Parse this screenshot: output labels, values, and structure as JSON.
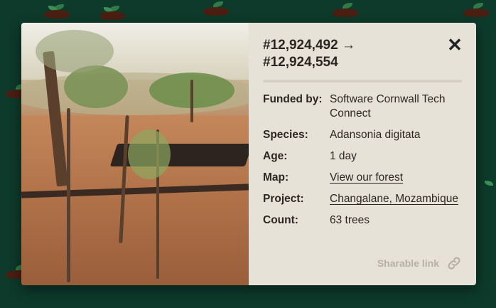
{
  "modal": {
    "title_line1": "#12,924,492 →",
    "title_line2": "#12,924,554",
    "close_label": "✕",
    "details": [
      {
        "label": "Funded by:",
        "value": "Software Cornwall Tech Connect"
      },
      {
        "label": "Species:",
        "value": "Adansonia digitata"
      },
      {
        "label": "Age:",
        "value": "1 day"
      },
      {
        "label": "Map:",
        "value": "View our forest"
      },
      {
        "label": "Project:",
        "value": "Changalane, Mozambique"
      },
      {
        "label": "Count:",
        "value": "63 trees"
      }
    ],
    "share_label": "Sharable link"
  },
  "colors": {
    "background": "#0d3a2a",
    "panel": "#e7e2d8",
    "text": "#2c2622",
    "muted": "#b7b0a5"
  },
  "icons": {
    "close": "close-icon",
    "share": "link-icon"
  }
}
